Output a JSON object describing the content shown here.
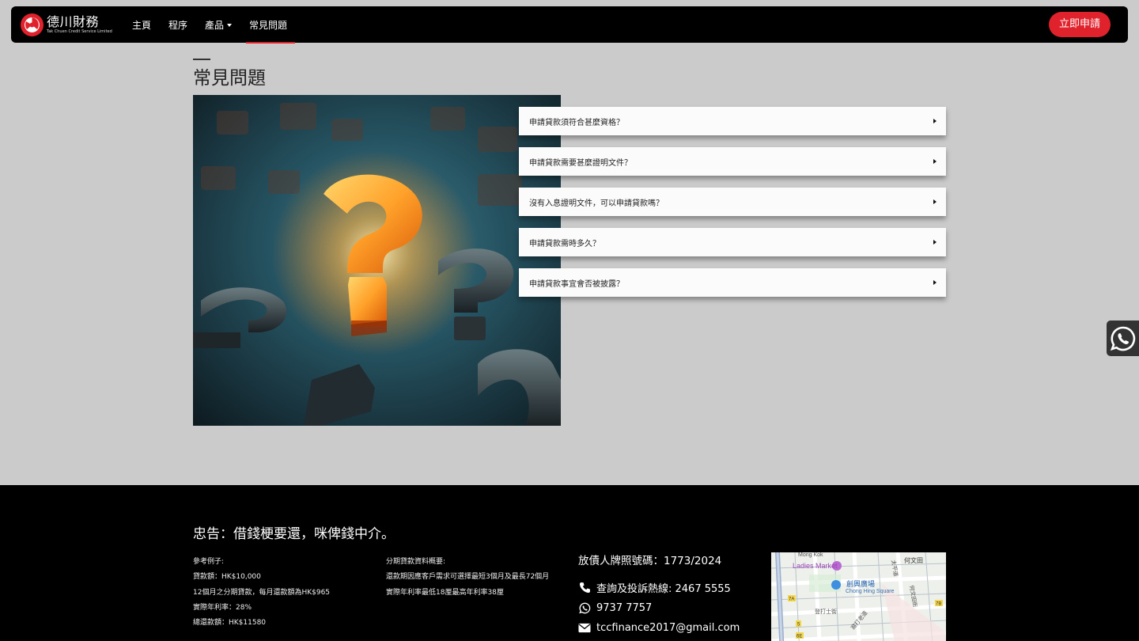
{
  "brand": {
    "name_cn": "德川財務",
    "name_en": "Tak Chuen Credit Service Limited"
  },
  "nav": {
    "items": [
      {
        "label": "主頁"
      },
      {
        "label": "程序"
      },
      {
        "label": "產品"
      },
      {
        "label": "常見問題"
      }
    ],
    "active": "常見問題",
    "apply_label": "立即申請"
  },
  "page": {
    "title": "常見問題"
  },
  "faq": [
    {
      "question": "申請貸款須符合甚麼資格？"
    },
    {
      "question": "申請貸款需要甚麼證明文件？"
    },
    {
      "question": "沒有入息證明文件，可以申請貸款嗎？"
    },
    {
      "question": "申請貸款需時多久？"
    },
    {
      "question": "申請貸款事宜會否被披露？"
    }
  ],
  "footer": {
    "warning": "忠告：借錢梗要還，咪俾錢中介。",
    "example": {
      "heading": "參考例子:",
      "lines": [
        "貸款額：HK$10,000",
        "12個月之分期貸款，每月還款額為HK$965",
        "實際年利率：28%",
        "總還款額：HK$11580"
      ]
    },
    "summary": {
      "heading": "分期貸款資料概要:",
      "lines": [
        "還款期因應客戶需求可選擇最短3個月及最長72個月",
        "實際年利率最低18厘最高年利率38厘"
      ]
    },
    "contact": {
      "license": "放債人牌照號碼：1773/2024",
      "hotline": "查詢及投訴熱線: 2467 5555",
      "whatsapp": "9737 7757",
      "email": "tccfinance2017@gmail.com"
    },
    "map": {
      "labels": [
        "Mong Kok",
        "Ladies Market",
        "創興廣場",
        "Chong Hing Square",
        "何文田",
        "登打士街",
        "窩打老道",
        "太平道",
        "何文田街",
        "7A",
        "7B",
        "5",
        "6E"
      ]
    }
  },
  "colors": {
    "accent": "#e0222c",
    "nav_bg": "#000000",
    "page_bg": "#cbcbcb"
  }
}
